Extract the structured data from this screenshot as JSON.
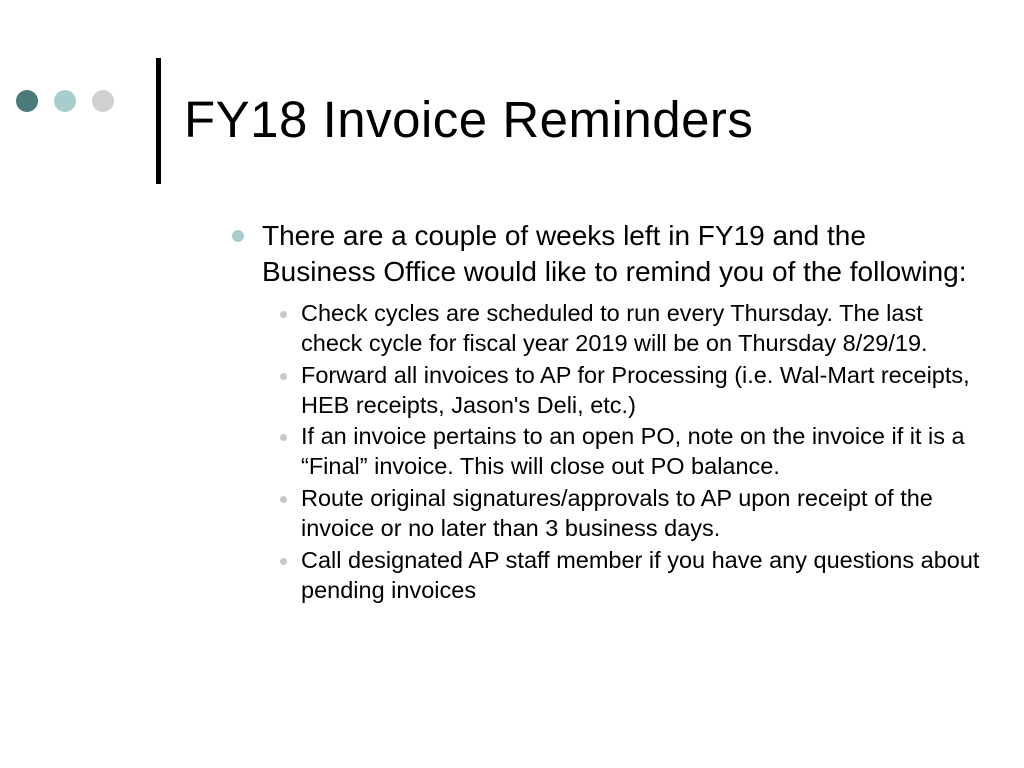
{
  "title": "FY18 Invoice Reminders",
  "main_point": "There are a couple of weeks left in FY19 and the Business Office would like to remind you of the following:",
  "sub_points": [
    "Check cycles are scheduled to run every Thursday. The last check cycle for fiscal year 2019 will be on Thursday 8/29/19.",
    "Forward all invoices to AP for Processing (i.e. Wal-Mart receipts, HEB receipts, Jason's Deli, etc.)",
    "If an invoice pertains to an open PO, note on the invoice if it is a “Final” invoice.  This will close out PO balance.",
    "Route original signatures/approvals to AP upon receipt of the invoice or no later than 3 business days.",
    "Call designated AP staff member if you have any questions about pending invoices"
  ],
  "colors": {
    "dot1": "#4a7a7a",
    "dot2": "#a8cdcd",
    "dot3": "#d0d0d0"
  }
}
